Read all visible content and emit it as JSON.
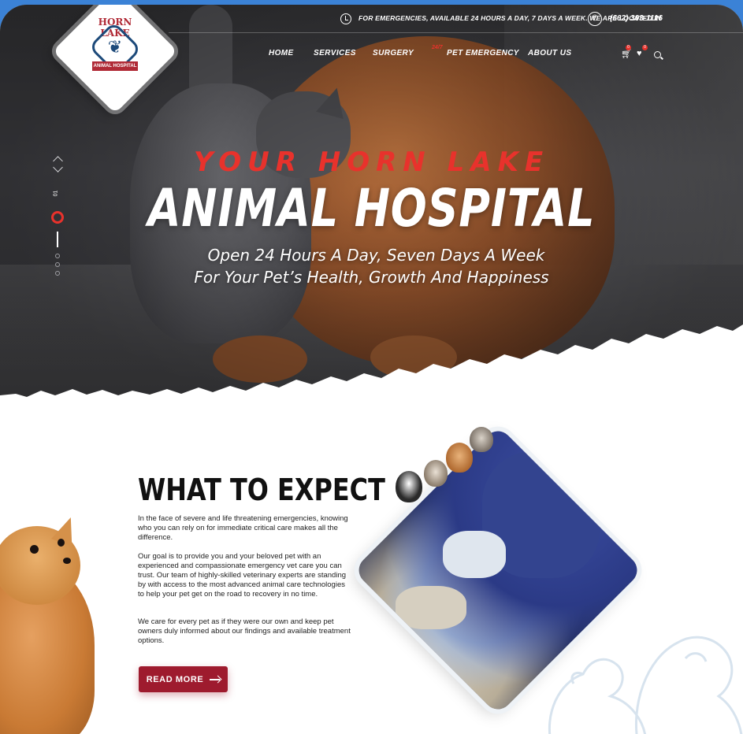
{
  "topbar": {
    "emergency_notice": "FOR EMERGENCIES, AVAILABLE 24 HOURS A DAY, 7 DAYS A WEEK. WE ARE LOCATED IN",
    "phone": "(662) 393-1116"
  },
  "logo": {
    "title": "HORN LAKE",
    "ribbon": "ANIMAL HOSPITAL"
  },
  "nav": {
    "home": "HOME",
    "services": "SERVICES",
    "surgery": "SURGERY",
    "emergency_badge": "24/7",
    "emergency": "PET EMERGENCY",
    "about": "ABOUT US",
    "cart_count": "0",
    "wishlist_count": "0"
  },
  "slider": {
    "current": "01",
    "total_dots": 3
  },
  "hero": {
    "kicker": "YOUR HORN LAKE",
    "title": "ANIMAL HOSPITAL",
    "subtitle_line1": "Open 24 Hours A Day, Seven Days A Week",
    "subtitle_line2": "For Your Pet’s Health, Growth And Happiness"
  },
  "expect": {
    "title": "WHAT TO EXPECT",
    "paragraph1": "In the face of severe and life threatening emergencies, knowing who you can rely on for immediate critical care makes all the difference.",
    "paragraph2": "Our goal is to provide you and your beloved pet with an experienced and compassionate emergency vet care you can trust. Our team of highly-skilled veterinary experts are standing by with access to the most advanced animal care technologies to help your pet get on the road to recovery in no time.",
    "paragraph3": "We care for every pet as if they were our own and keep pet owners duly informed about our findings and available treatment options.",
    "button": "READ MORE"
  },
  "colors": {
    "accent_red": "#e8322c",
    "button_maroon": "#9e1b2e",
    "frame_blue": "#3b82d6"
  }
}
